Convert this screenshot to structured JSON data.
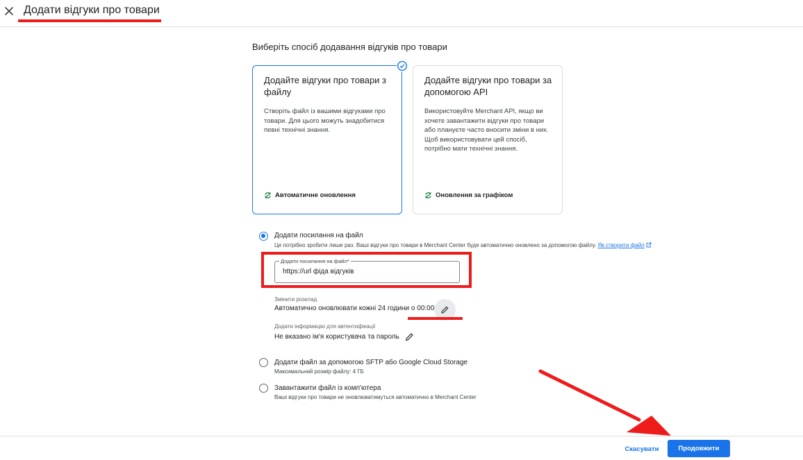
{
  "header": {
    "title": "Додати відгуки про товари"
  },
  "method_picker": {
    "heading": "Виберіть спосіб додавання відгуків про товари",
    "cards": [
      {
        "title": "Додайте відгуки про товари з файлу",
        "description": "Створіть файл із вашими відгуками про товари. Для цього можуть знадобитися певні технічні знання.",
        "footer": "Автоматичне оновлення",
        "selected": true
      },
      {
        "title": "Додайте відгуки про товари за допомогою API",
        "description": "Використовуйте Merchant API, якщо ви хочете завантажити відгуки про товари або плануєте часто вносити зміни в них. Щоб використовувати цей спосіб, потрібно мати технічні знання.",
        "footer": "Оновлення за графіком",
        "selected": false
      }
    ]
  },
  "options": {
    "link": {
      "label": "Додати посилання на файл",
      "sub": "Це потрібно зробити лише раз. Ваші відгуки про товари в Merchant Center буде автоматично оновлено за допомогою файлу.",
      "help_link": "Як створити файл",
      "selected": true,
      "url_field": {
        "label": "Додати посилання на файл*",
        "value": "https://url фіда відгуків"
      },
      "schedule": {
        "label": "Змінити розклад",
        "value": "Автоматично оновлювати кожні 24 години о 00:00"
      },
      "auth": {
        "label": "Додати інформацію для автентифікації",
        "value": "Не вказано ім'я користувача та пароль"
      }
    },
    "sftp": {
      "label": "Додати файл за допомогою SFTP або Google Cloud Storage",
      "sub": "Максимальний розмір файлу: 4 ГБ",
      "selected": false
    },
    "upload": {
      "label": "Завантажити файл із комп'ютера",
      "sub": "Ваші відгуки про товари не оновлюватимуться автоматично в Merchant Center",
      "selected": false
    }
  },
  "footer": {
    "cancel": "Скасувати",
    "continue": "Продовжити"
  },
  "colors": {
    "accent": "#1a73e8",
    "annotation": "#ee1b1b",
    "sync_icon": "#188038"
  }
}
